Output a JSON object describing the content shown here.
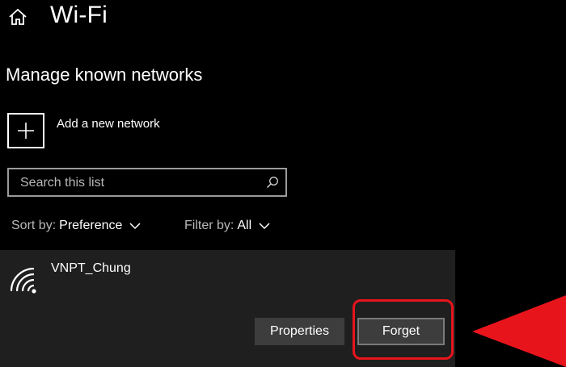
{
  "header": {
    "title": "Wi-Fi",
    "home_icon": "home-icon"
  },
  "section": {
    "heading": "Manage known networks"
  },
  "add_network": {
    "label": "Add a new network",
    "icon": "plus-icon"
  },
  "search": {
    "placeholder": "Search this list",
    "value": "",
    "icon": "search-icon"
  },
  "sort": {
    "label": "Sort by:",
    "value": "Preference"
  },
  "filter": {
    "label": "Filter by:",
    "value": "All"
  },
  "network": {
    "name": "VNPT_Chung",
    "icon": "wifi-icon",
    "properties_label": "Properties",
    "forget_label": "Forget"
  },
  "annotation": {
    "highlight_color": "#e8141c",
    "arrow_color": "#e8141c"
  },
  "colors": {
    "background": "#000000",
    "panel": "#1f1f1f",
    "button": "#3d3d3d",
    "text": "#ffffff",
    "muted_text": "#b8b8b8"
  }
}
